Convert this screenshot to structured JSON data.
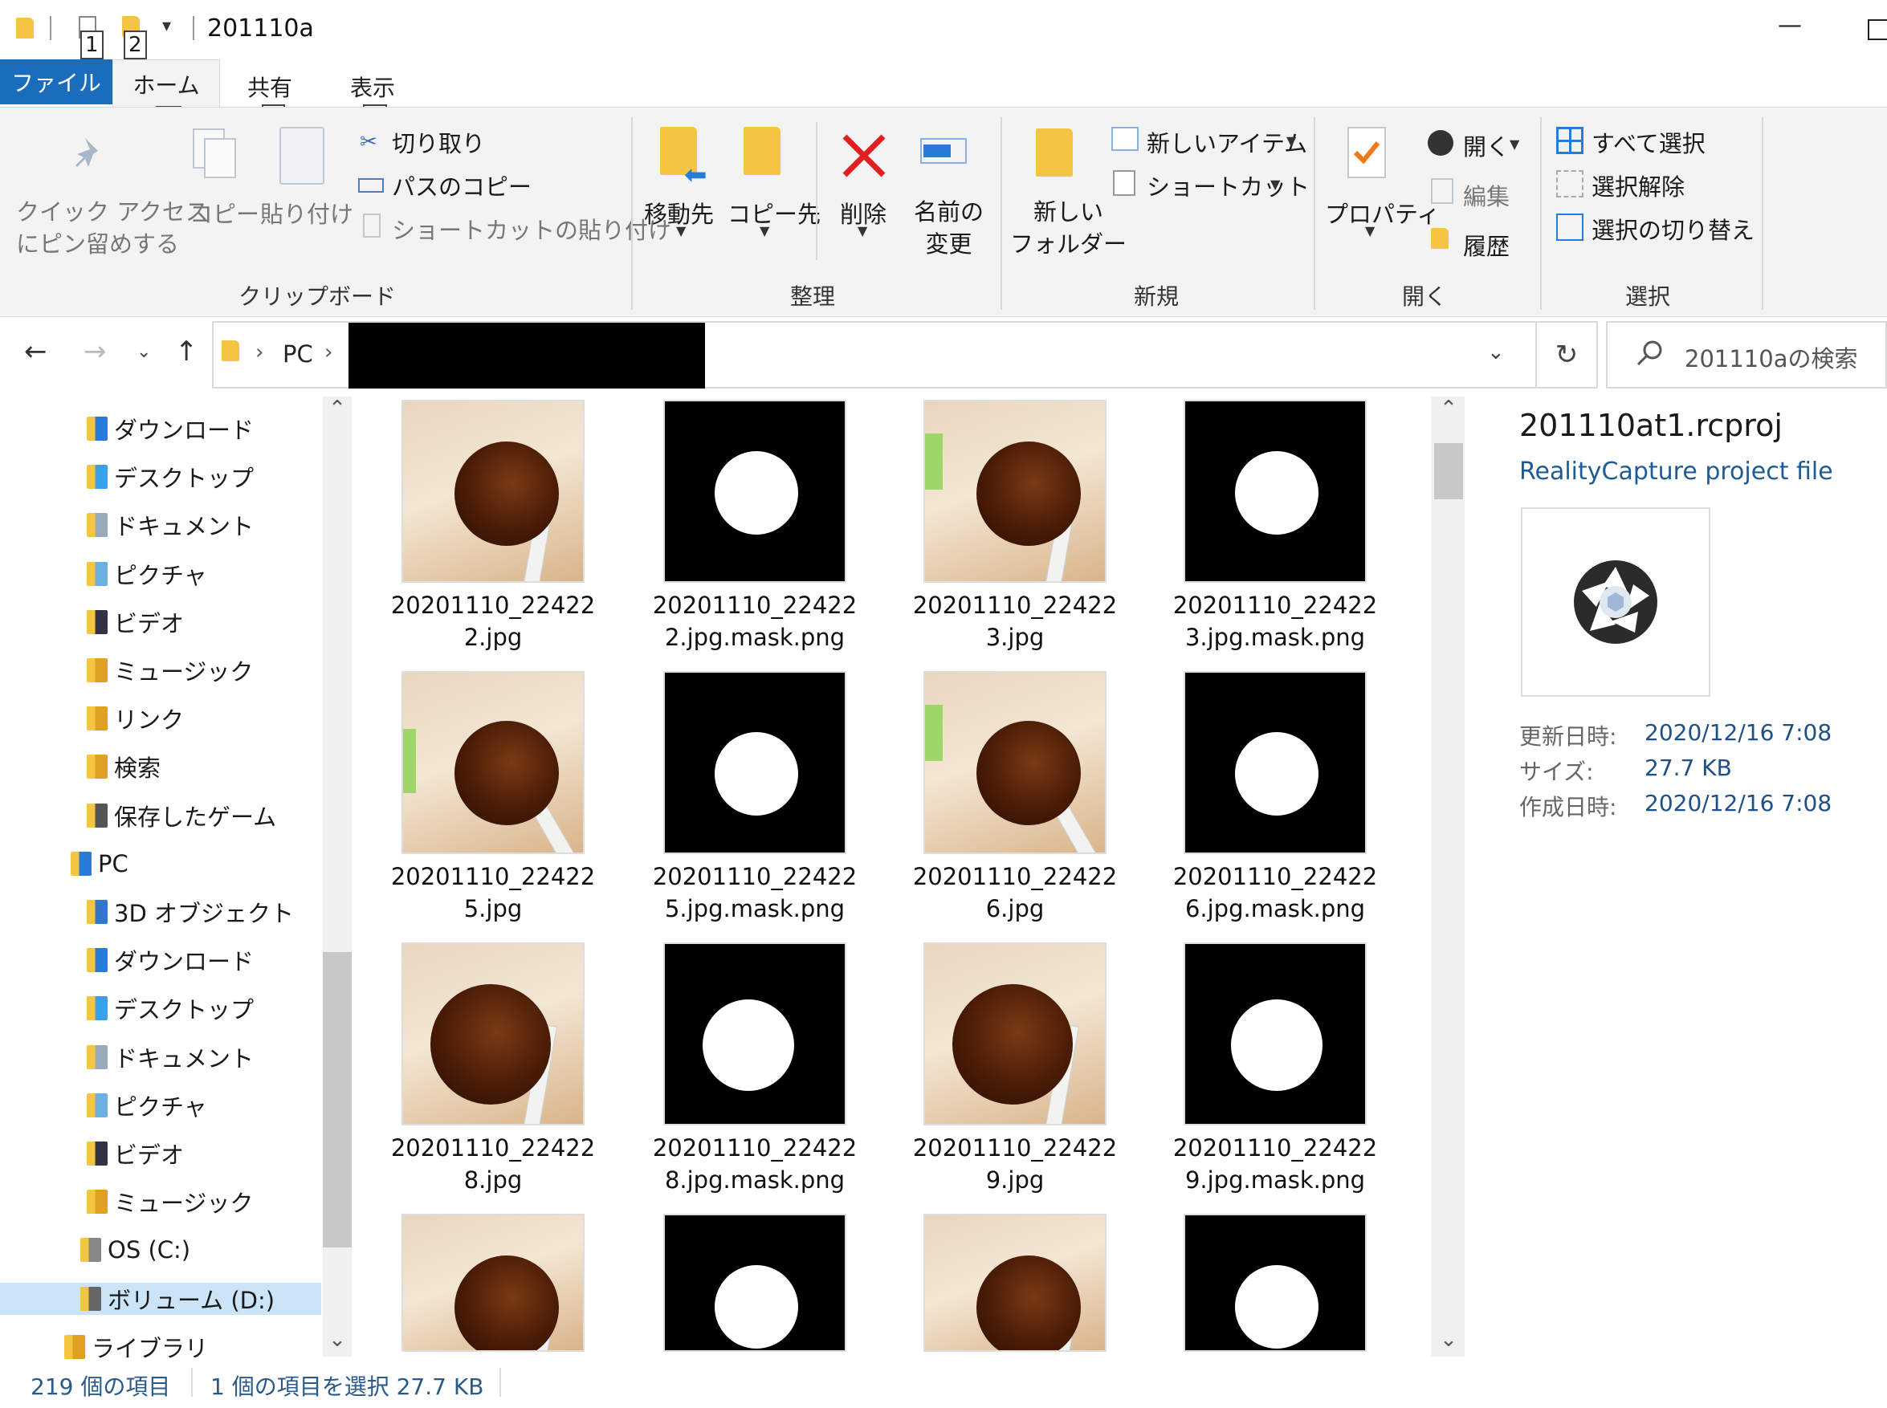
{
  "window": {
    "title": "201110a",
    "keytips": {
      "qat1": "1",
      "qat2": "2"
    }
  },
  "tabs": [
    {
      "label": "ファイル",
      "active": true
    },
    {
      "label": "ホーム",
      "keytip": "H"
    },
    {
      "label": "共有",
      "keytip": "S"
    },
    {
      "label": "表示",
      "keytip": "V"
    }
  ],
  "ribbon": {
    "clipboard": {
      "pin": [
        "クイック アクセス",
        "にピン留めする"
      ],
      "copy": "コピー",
      "paste": "貼り付け",
      "cut": "切り取り",
      "copy_path": "パスのコピー",
      "paste_shortcut": "ショートカットの貼り付け",
      "group": "クリップボード"
    },
    "organize": {
      "move_to": "移動先",
      "copy_to": "コピー先",
      "delete": "削除",
      "rename": [
        "名前の",
        "変更"
      ],
      "group": "整理"
    },
    "new": {
      "new_folder": [
        "新しい",
        "フォルダー"
      ],
      "new_item": "新しいアイテム",
      "shortcut": "ショートカット",
      "group": "新規"
    },
    "open": {
      "properties": "プロパティ",
      "open": "開く",
      "edit": "編集",
      "history": "履歴",
      "group": "開く"
    },
    "select": {
      "select_all": "すべて選択",
      "select_none": "選択解除",
      "invert": "選択の切り替え",
      "group": "選択"
    }
  },
  "address": {
    "crumb_pc": "PC",
    "search_placeholder": "201110aの検索"
  },
  "nav": [
    {
      "label": "ダウンロード"
    },
    {
      "label": "デスクトップ"
    },
    {
      "label": "ドキュメント"
    },
    {
      "label": "ピクチャ"
    },
    {
      "label": "ビデオ"
    },
    {
      "label": "ミュージック"
    },
    {
      "label": "リンク"
    },
    {
      "label": "検索"
    },
    {
      "label": "保存したゲーム"
    },
    {
      "label": "PC"
    },
    {
      "label": "3D オブジェクト"
    },
    {
      "label": "ダウンロード"
    },
    {
      "label": "デスクトップ"
    },
    {
      "label": "ドキュメント"
    },
    {
      "label": "ピクチャ"
    },
    {
      "label": "ビデオ"
    },
    {
      "label": "ミュージック"
    },
    {
      "label": "OS (C:)"
    },
    {
      "label": "ボリューム (D:)"
    },
    {
      "label": "ライブラリ"
    }
  ],
  "files": [
    {
      "line1": "20201110_22422",
      "line2": "2.jpg"
    },
    {
      "line1": "20201110_22422",
      "line2": "2.jpg.mask.png"
    },
    {
      "line1": "20201110_22422",
      "line2": "3.jpg"
    },
    {
      "line1": "20201110_22422",
      "line2": "3.jpg.mask.png"
    },
    {
      "line1": "20201110_22422",
      "line2": "5.jpg"
    },
    {
      "line1": "20201110_22422",
      "line2": "5.jpg.mask.png"
    },
    {
      "line1": "20201110_22422",
      "line2": "6.jpg"
    },
    {
      "line1": "20201110_22422",
      "line2": "6.jpg.mask.png"
    },
    {
      "line1": "20201110_22422",
      "line2": "8.jpg"
    },
    {
      "line1": "20201110_22422",
      "line2": "8.jpg.mask.png"
    },
    {
      "line1": "20201110_22422",
      "line2": "9.jpg"
    },
    {
      "line1": "20201110_22422",
      "line2": "9.jpg.mask.png"
    }
  ],
  "details": {
    "name": "201110at1.rcproj",
    "type": "RealityCapture project file",
    "modified_label": "更新日時:",
    "modified": "2020/12/16 7:08",
    "size_label": "サイズ:",
    "size": "27.7 KB",
    "created_label": "作成日時:",
    "created": "2020/12/16 7:08"
  },
  "status": {
    "count": "219 個の項目",
    "selection": "1 個の項目を選択  27.7 KB"
  }
}
